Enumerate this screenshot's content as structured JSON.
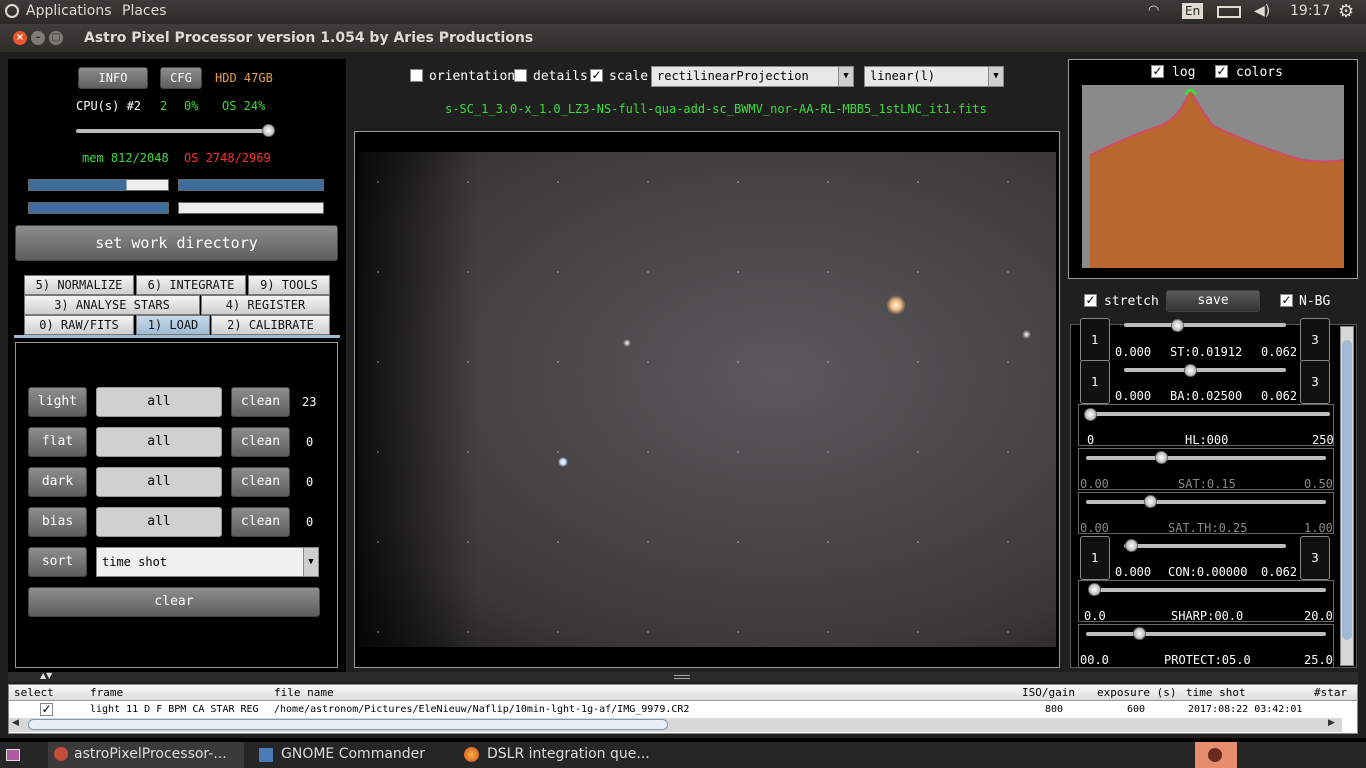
{
  "top_panel": {
    "applications": "Applications",
    "places": "Places",
    "lang": "En",
    "time": "19:17"
  },
  "window": {
    "title": "Astro Pixel Processor version 1.054 by Aries Productions"
  },
  "left": {
    "info_btn": "INFO",
    "cfg_btn": "CFG",
    "hdd": "HDD 47GB",
    "cpu_label": "CPU(s) #2",
    "cpu_count": "2",
    "cpu_pct": "0%",
    "os_pct": "OS 24%",
    "mem": "mem 812/2048",
    "os_mem": "OS 2748/2969",
    "set_work_dir": "set work directory",
    "tabs_row1": [
      "5) NORMALIZE",
      "6) INTEGRATE",
      "9) TOOLS"
    ],
    "tabs_row2": [
      "3) ANALYSE STARS",
      "4) REGISTER"
    ],
    "tabs_row3": [
      "0) RAW/FITS",
      "1) LOAD",
      "2) CALIBRATE"
    ],
    "rows": [
      {
        "type": "light",
        "all": "all",
        "clean": "clean",
        "count": "23"
      },
      {
        "type": "flat",
        "all": "all",
        "clean": "clean",
        "count": "0"
      },
      {
        "type": "dark",
        "all": "all",
        "clean": "clean",
        "count": "0"
      },
      {
        "type": "bias",
        "all": "all",
        "clean": "clean",
        "count": "0"
      }
    ],
    "sort_btn": "sort",
    "sort_value": "time shot",
    "clear_btn": "clear"
  },
  "center": {
    "orientation": "orientation",
    "details": "details",
    "scale": "scale",
    "projection": "rectilinearProjection",
    "stretch_mode": "linear(l)",
    "filename": "s-SC_1_3.0-x_1.0_LZ3-NS-full-qua-add-sc_BWMV_nor-AA-RL-MBB5_1stLNC_it1.fits"
  },
  "right": {
    "log": "log",
    "colors": "colors",
    "stretch": "stretch",
    "save": "save",
    "nbg": "N-BG",
    "st": {
      "left": "1",
      "right": "3",
      "min": "0.000",
      "label": "ST:0.01912",
      "max": "0.062"
    },
    "ba": {
      "left": "1",
      "right": "3",
      "min": "0.000",
      "label": "BA:0.02500",
      "max": "0.062"
    },
    "hl": {
      "min": "0",
      "label": "HL:000",
      "max": "250"
    },
    "sat": {
      "min": "0.00",
      "label": "SAT:0.15",
      "max": "0.50"
    },
    "satth": {
      "min": "0.00",
      "label": "SAT.TH:0.25",
      "max": "1.00"
    },
    "con": {
      "left": "1",
      "right": "3",
      "min": "0.000",
      "label": "CON:0.00000",
      "max": "0.062"
    },
    "sharp": {
      "min": "0.0",
      "label": "SHARP:00.0",
      "max": "20.0"
    },
    "protect": {
      "min": "00.0",
      "label": "PROTECT:05.0",
      "max": "25.0"
    }
  },
  "table": {
    "headers": [
      "select",
      "frame",
      "file name",
      "ISO/gain",
      "exposure (s)",
      "time shot",
      "#star"
    ],
    "row": {
      "frame": "light 11 D F BPM CA STAR REG",
      "file": "/home/astronom/Pictures/EleNieuw/Naflip/10min-lght-1g-af/IMG_9979.CR2",
      "iso": "800",
      "exposure": "600",
      "time": "2017:08:22 03:42:01"
    }
  },
  "taskbar": {
    "item1": "astroPixelProcessor-...",
    "item2": "GNOME Commander",
    "item3": "DSLR integration que..."
  }
}
